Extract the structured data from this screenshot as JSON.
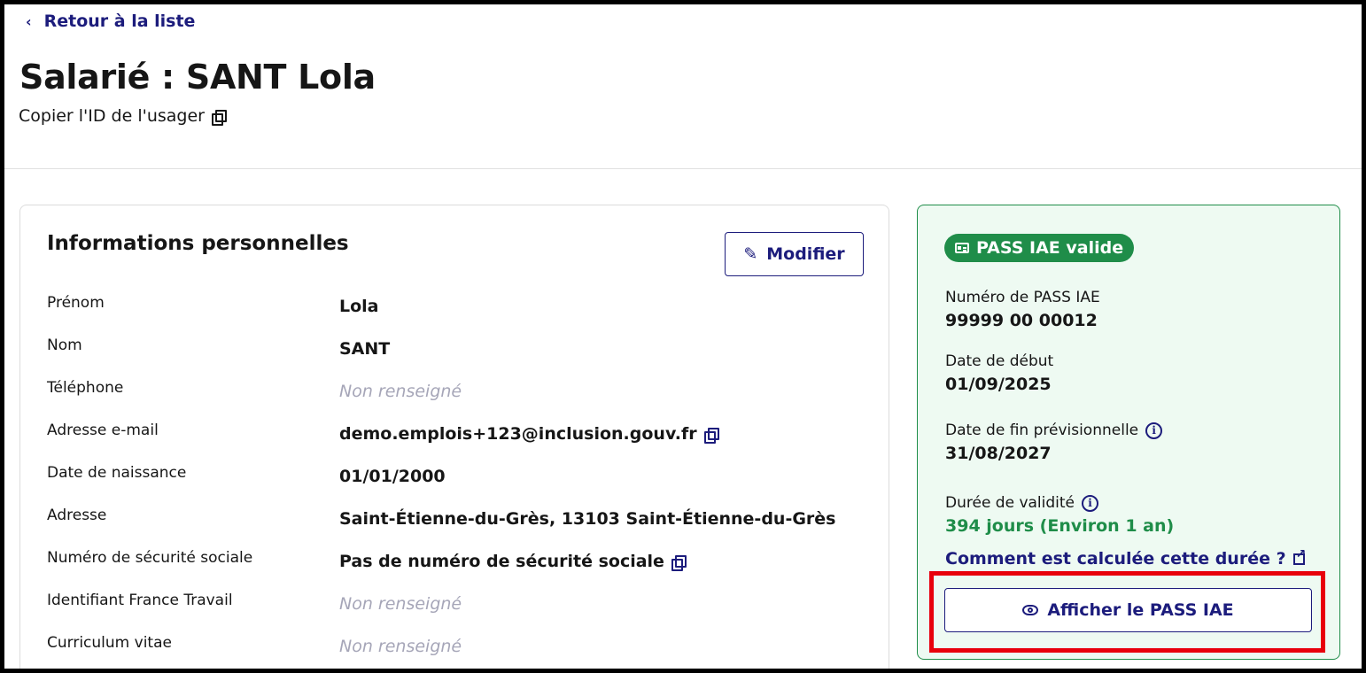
{
  "nav": {
    "back_label": "Retour à la liste"
  },
  "page": {
    "title": "Salarié : SANT Lola",
    "copy_id_label": "Copier l'ID de l'usager"
  },
  "personal_info": {
    "heading": "Informations personnelles",
    "edit_label": "Modifier",
    "rows": [
      {
        "label": "Prénom",
        "value": "Lola"
      },
      {
        "label": "Nom",
        "value": "SANT"
      },
      {
        "label": "Téléphone",
        "value": "Non renseigné"
      },
      {
        "label": "Adresse e-mail",
        "value": "demo.emplois+123@inclusion.gouv.fr"
      },
      {
        "label": "Date de naissance",
        "value": "01/01/2000"
      },
      {
        "label": "Adresse",
        "value": "Saint-Étienne-du-Grès, 13103 Saint-Étienne-du-Grès"
      },
      {
        "label": "Numéro de sécurité sociale",
        "value": "Pas de numéro de sécurité sociale"
      },
      {
        "label": "Identifiant France Travail",
        "value": "Non renseigné"
      },
      {
        "label": "Curriculum vitae",
        "value": "Non renseigné"
      }
    ]
  },
  "pass": {
    "badge": "PASS IAE valide",
    "number_label": "Numéro de PASS IAE",
    "number_value": "99999 00 00012",
    "start_label": "Date de début",
    "start_value": "01/09/2025",
    "end_label": "Date de fin prévisionnelle",
    "end_value": "31/08/2027",
    "duration_label": "Durée de validité",
    "duration_value": "394 jours (Environ 1 an)",
    "calc_link": "Comment est calculée cette durée ?",
    "show_button": "Afficher le PASS IAE"
  },
  "colors": {
    "primary": "#1c1c7c",
    "success": "#1f8d49",
    "success_bg": "#eefaf2",
    "highlight": "#e8000b"
  }
}
